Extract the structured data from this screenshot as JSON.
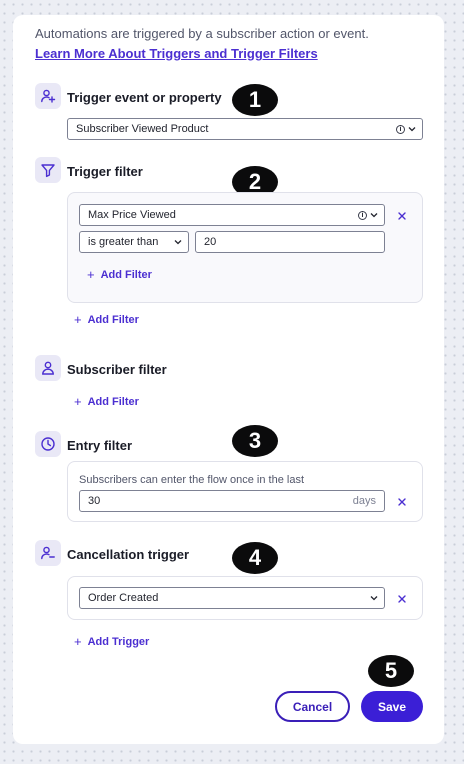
{
  "intro": {
    "text": "Automations are triggered by a subscriber action or event.",
    "link": "Learn More About Triggers and Trigger Filters"
  },
  "trigger": {
    "title": "Trigger event or property",
    "value": "Subscriber Viewed Product",
    "badge": "1"
  },
  "trigger_filter": {
    "title": "Trigger filter",
    "badge": "2",
    "field": "Max Price Viewed",
    "operator": "is greater than",
    "amount": "20",
    "inner_add": "Add Filter",
    "outer_add": "Add Filter"
  },
  "subscriber_filter": {
    "title": "Subscriber filter",
    "add": "Add Filter"
  },
  "entry_filter": {
    "title": "Entry filter",
    "badge": "3",
    "hint": "Subscribers can enter the flow once in the last",
    "value": "30",
    "unit": "days"
  },
  "cancellation": {
    "title": "Cancellation trigger",
    "badge": "4",
    "value": "Order Created",
    "add": "Add Trigger"
  },
  "footer": {
    "cancel": "Cancel",
    "save": "Save",
    "badge": "5"
  },
  "colors": {
    "accent": "#4b2fd1",
    "save_bg": "#3b1fd6",
    "icon_bg": "#e9e8f6"
  }
}
